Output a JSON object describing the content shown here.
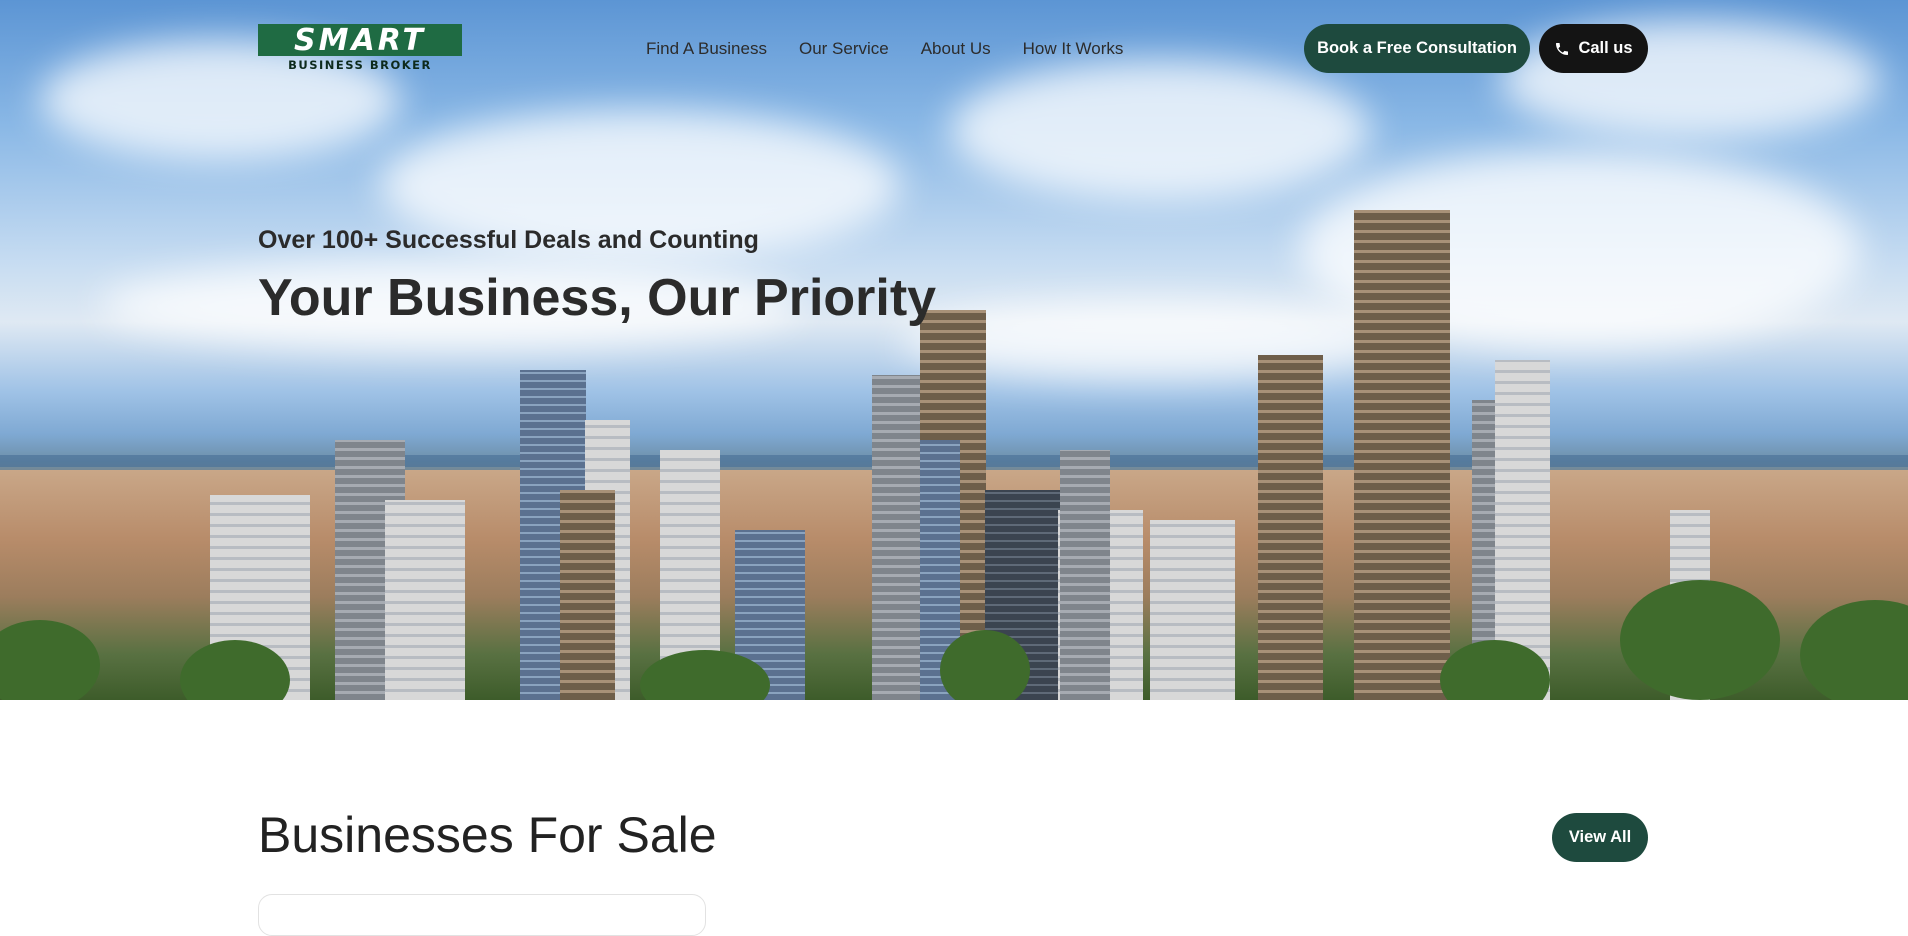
{
  "brand": {
    "logo_top": "SMART",
    "logo_bottom": "BUSINESS BROKER",
    "color": "#1f6b43"
  },
  "nav": {
    "items": [
      "Find A Business",
      "Our Service",
      "About Us",
      "How It Works"
    ]
  },
  "header": {
    "consult_label": "Book a Free Consultation",
    "call_label": "Call us",
    "call_icon": "phone-icon",
    "accent": "#1e4a3e"
  },
  "hero": {
    "subtitle": "Over 100+ Successful Deals and Counting",
    "title": "Your Business, Our Priority"
  },
  "listings": {
    "title": "Businesses For Sale",
    "view_all_label": "View All"
  }
}
